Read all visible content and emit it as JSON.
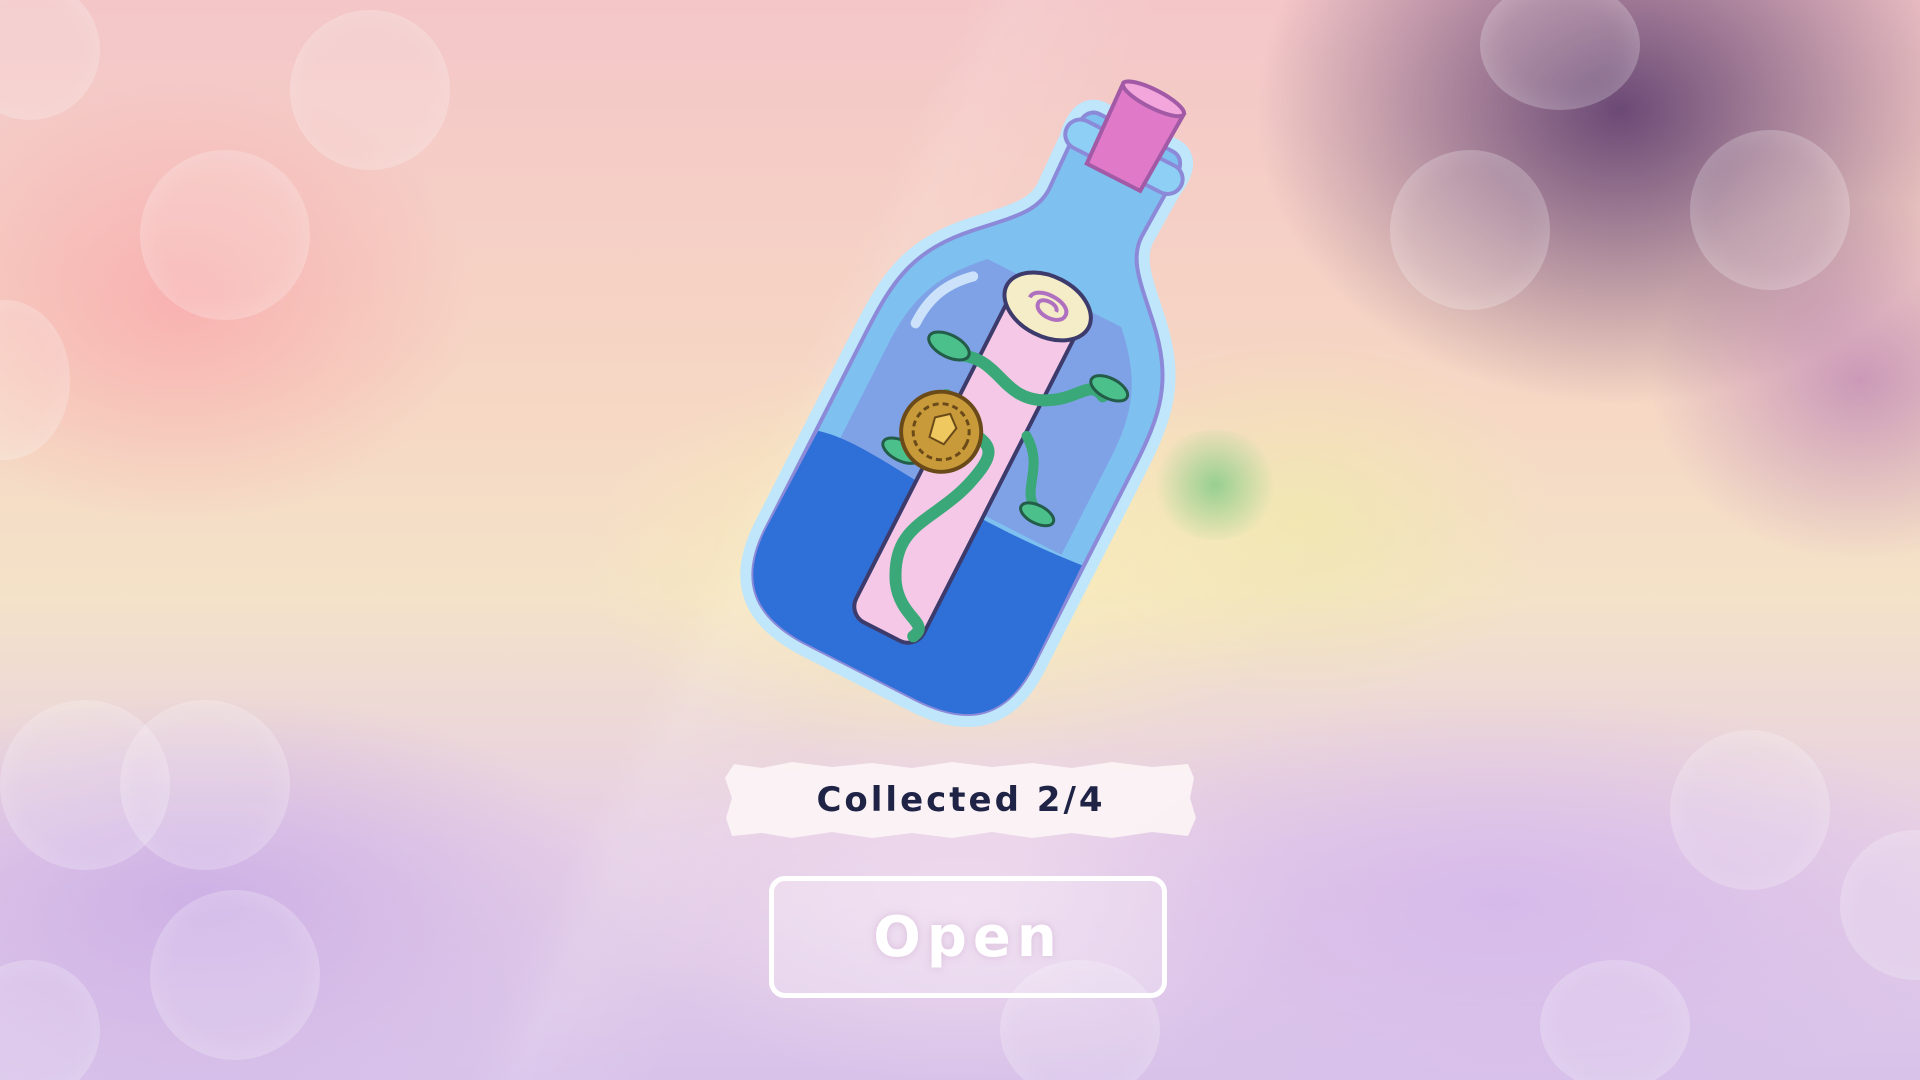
{
  "screen": {
    "name": "message-bottle-reward"
  },
  "item": {
    "icon": "message-in-bottle-icon",
    "colors": {
      "bottle_glass": "#7ec0f0",
      "water": "#2f6fd8",
      "cork": "#e07ac8",
      "scroll": "#f4c8e6",
      "seal": "#c89a3a",
      "vine": "#3aa878"
    }
  },
  "progress": {
    "label": "Collected 2/4",
    "collected": 2,
    "total": 4
  },
  "actions": {
    "open_label": "Open"
  },
  "theme": {
    "text_dark": "#1f2446",
    "button_border": "#ffffff"
  }
}
